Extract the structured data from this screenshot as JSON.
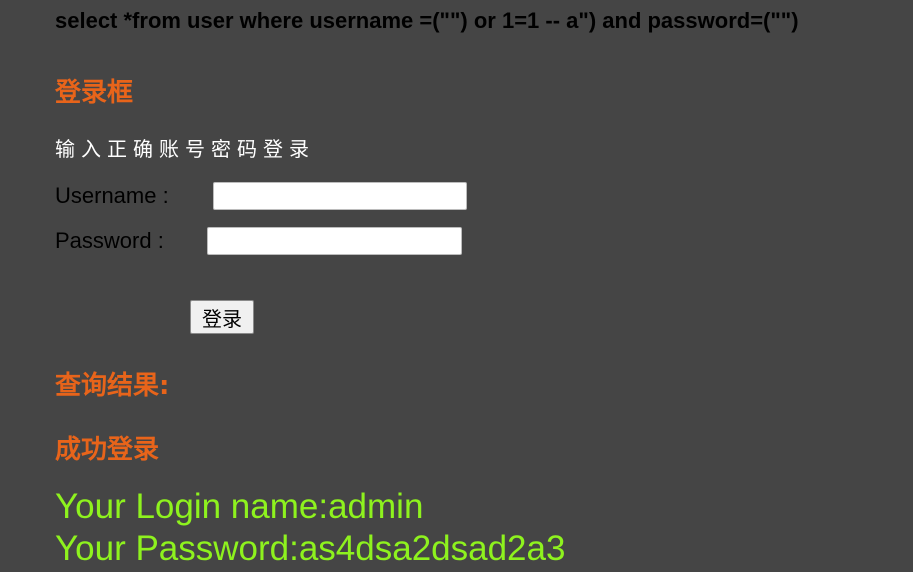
{
  "query": {
    "sql": "select *from user where username =(\"\") or 1=1 -- a\") and password=(\"\")"
  },
  "login": {
    "title": "登录框",
    "hint": "输入正确账号密码登录",
    "username_label": "Username :",
    "username_value": "",
    "password_label": "Password :",
    "password_value": "",
    "submit_label": "登录"
  },
  "result": {
    "title": "查询结果:",
    "status": "成功登录",
    "login_name_line": "Your Login name:admin",
    "password_line": "Your Password:as4dsa2dsad2a3"
  },
  "colors": {
    "background": "#454545",
    "heading": "#e8641a",
    "result_text": "#8ef21e",
    "sql_text": "#000000"
  }
}
